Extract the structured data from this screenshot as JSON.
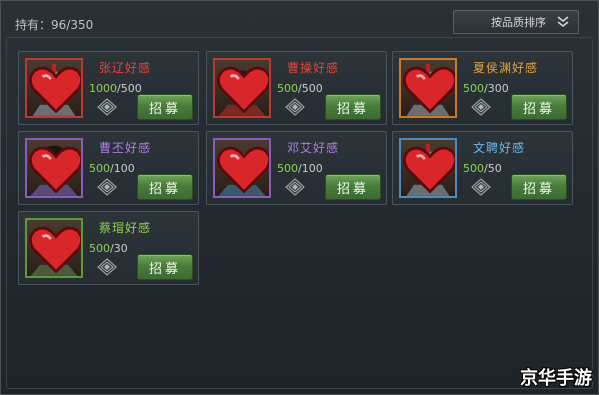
{
  "header": {
    "count_label": "持有：96/350",
    "sort_label": "按品质排序"
  },
  "cards": [
    {
      "name": "张辽好感",
      "current": "1000",
      "total": "/500",
      "name_color": "#e0463a",
      "frame_color": "#b83a30",
      "recruit_label": "招募",
      "portrait": "warrior-helmet"
    },
    {
      "name": "曹操好感",
      "current": "500",
      "total": "/500",
      "name_color": "#e0463a",
      "frame_color": "#b83a30",
      "recruit_label": "招募",
      "portrait": "lord"
    },
    {
      "name": "夏侯渊好感",
      "current": "500",
      "total": "/300",
      "name_color": "#e8a23a",
      "frame_color": "#c97a2a",
      "recruit_label": "招募",
      "portrait": "warrior-helmet"
    },
    {
      "name": "曹丕好感",
      "current": "500",
      "total": "/100",
      "name_color": "#b07ee0",
      "frame_color": "#8a5cc0",
      "recruit_label": "招募",
      "portrait": "young"
    },
    {
      "name": "邓艾好感",
      "current": "500",
      "total": "/100",
      "name_color": "#b07ee0",
      "frame_color": "#8a5cc0",
      "recruit_label": "招募",
      "portrait": "scholar"
    },
    {
      "name": "文聘好感",
      "current": "500",
      "total": "/50",
      "name_color": "#6fb8e8",
      "frame_color": "#4a8cc0",
      "recruit_label": "招募",
      "portrait": "warrior-helmet"
    },
    {
      "name": "蔡瑁好感",
      "current": "500",
      "total": "/30",
      "name_color": "#8fd14f",
      "frame_color": "#5a9a3a",
      "recruit_label": "招募",
      "portrait": "warrior-cap"
    }
  ],
  "icons": {
    "heart": "heart-icon",
    "rank": "rank-emblem-icon",
    "chevron": "double-chevron-down-icon"
  },
  "watermark": "京华手游"
}
